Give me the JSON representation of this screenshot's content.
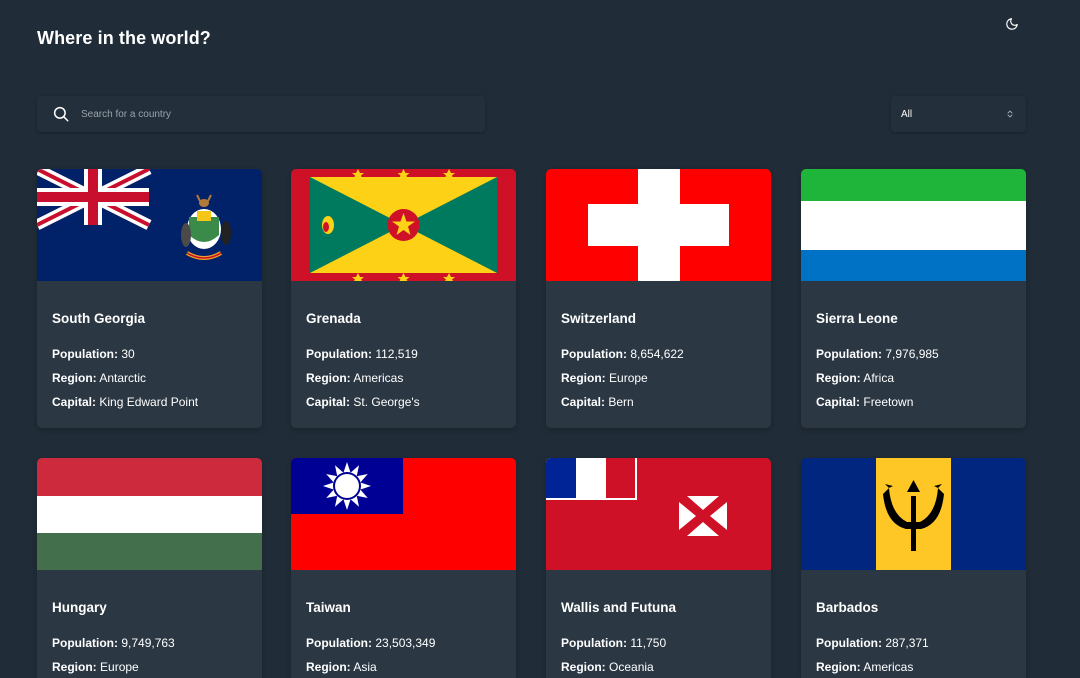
{
  "header": {
    "title": "Where in the world?"
  },
  "icons": {
    "theme": "moon-icon",
    "search": "search-icon",
    "select": "chevron-updown-icon"
  },
  "search": {
    "placeholder": "Search for a country",
    "value": ""
  },
  "filter": {
    "selected": "All"
  },
  "labels": {
    "population": "Population:",
    "region": "Region:",
    "capital": "Capital:"
  },
  "colors": {
    "background": "#202c37",
    "card": "#2b3743",
    "text": "#ffffff"
  },
  "countries": [
    {
      "name": "South Georgia",
      "population": "30",
      "region": "Antarctic",
      "capital": "King Edward Point"
    },
    {
      "name": "Grenada",
      "population": "112,519",
      "region": "Americas",
      "capital": "St. George's"
    },
    {
      "name": "Switzerland",
      "population": "8,654,622",
      "region": "Europe",
      "capital": "Bern"
    },
    {
      "name": "Sierra Leone",
      "population": "7,976,985",
      "region": "Africa",
      "capital": "Freetown"
    },
    {
      "name": "Hungary",
      "population": "9,749,763",
      "region": "Europe",
      "capital": ""
    },
    {
      "name": "Taiwan",
      "population": "23,503,349",
      "region": "Asia",
      "capital": ""
    },
    {
      "name": "Wallis and Futuna",
      "population": "11,750",
      "region": "Oceania",
      "capital": ""
    },
    {
      "name": "Barbados",
      "population": "287,371",
      "region": "Americas",
      "capital": ""
    }
  ]
}
